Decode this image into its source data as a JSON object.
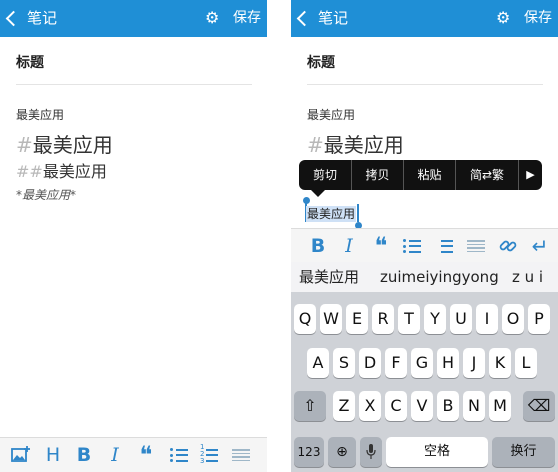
{
  "left": {
    "nav": {
      "back_label": "笔记",
      "save_label": "保存"
    },
    "title_placeholder": "标题",
    "lines": {
      "small": "最美应用",
      "h1_mark": "#",
      "h1_text": "最美应用",
      "h2_mark": "##",
      "h2_text": "最美应用",
      "italic": "*最美应用*"
    },
    "toolbar": {
      "heading": "H",
      "bold": "B",
      "italic": "I",
      "quote": "❝",
      "ordered_nums": "1 2 3"
    }
  },
  "right": {
    "nav": {
      "back_label": "笔记",
      "save_label": "保存"
    },
    "title_placeholder": "标题",
    "lines": {
      "small": "最美应用",
      "h1_mark": "#",
      "h1_text": "最美应用",
      "selected": "最美应用"
    },
    "context_menu": {
      "cut": "剪切",
      "copy": "拷贝",
      "paste": "粘贴",
      "convert": "简⇄繁"
    },
    "toolbar": {
      "bold": "B",
      "italic": "I",
      "quote": "❝"
    },
    "suggestions": [
      "最美应用",
      "zuimeiyingyong",
      "z u i"
    ],
    "keyboard": {
      "row1": [
        "Q",
        "W",
        "E",
        "R",
        "T",
        "Y",
        "U",
        "I",
        "O",
        "P"
      ],
      "row2": [
        "A",
        "S",
        "D",
        "F",
        "G",
        "H",
        "J",
        "K",
        "L"
      ],
      "row3": [
        "Z",
        "X",
        "C",
        "V",
        "B",
        "N",
        "M"
      ],
      "num_key": "123",
      "space_key": "空格",
      "return_key": "换行"
    }
  },
  "colors": {
    "navbar": "#1f8fd6",
    "accent": "#2f86c9",
    "keyboard_bg": "#cfd2d7"
  }
}
